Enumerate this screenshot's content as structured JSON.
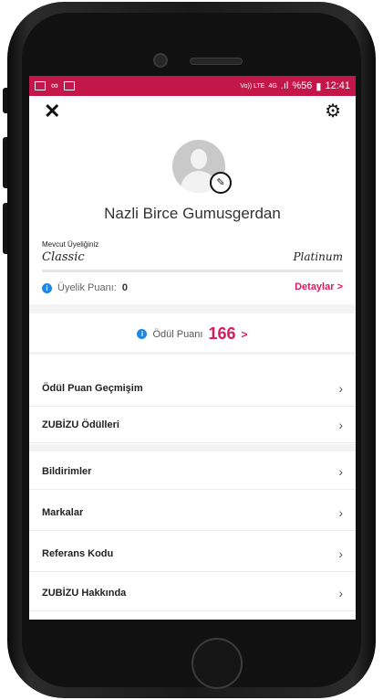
{
  "status_bar": {
    "carrier_small": "Vo)) LTE",
    "network": "4G",
    "battery_pct": "%56",
    "time": "12:41",
    "bg_color": "#c21748"
  },
  "header": {
    "close_icon": "close-icon",
    "settings_icon": "gear-icon"
  },
  "profile": {
    "name": "Nazli Birce Gumusgerdan",
    "edit_icon": "pencil-icon"
  },
  "membership": {
    "label": "Mevcut Üyeliğiniz",
    "current_level": "Classic",
    "next_level": "Platinum",
    "progress": 0,
    "points_label": "Üyelik Puanı:",
    "points_value": "0",
    "details_link": "Detaylar >"
  },
  "reward": {
    "label": "Ödül Puanı",
    "value": "166",
    "arrow": ">",
    "accent_color": "#d81b60"
  },
  "menu_group1": [
    {
      "label": "Ödül Puan Geçmişim"
    },
    {
      "label": "ZUBİZU Ödülleri"
    }
  ],
  "menu_group2": [
    {
      "label": "Bildirimler"
    },
    {
      "label": "Markalar"
    },
    {
      "label": "Referans Kodu"
    },
    {
      "label": "ZUBİZU Hakkında"
    }
  ]
}
